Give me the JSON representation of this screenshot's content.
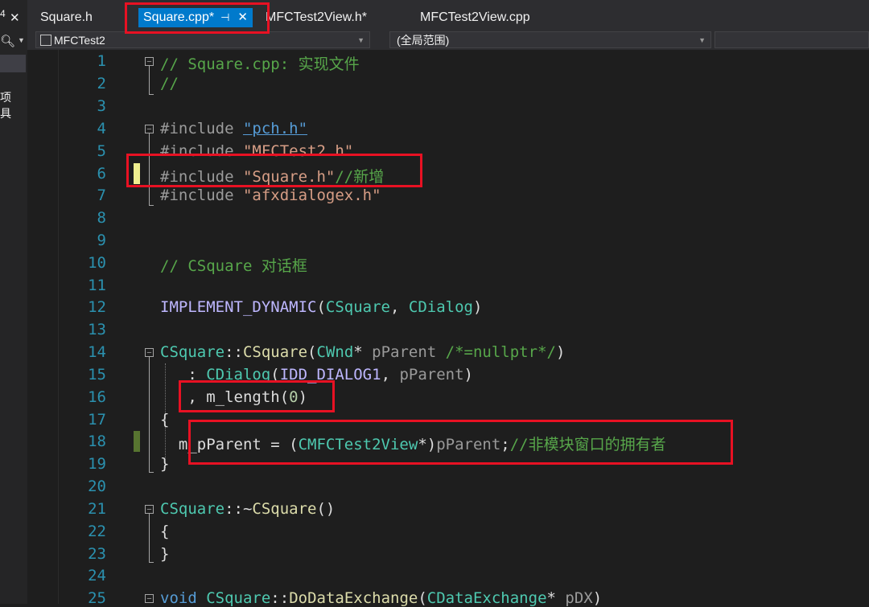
{
  "left_panel": {
    "glyph_top": "4",
    "glyph_close": "✕",
    "text1": "项",
    "text2": "具"
  },
  "tabs": [
    {
      "label": "Square.h"
    },
    {
      "label": "Square.cpp*",
      "active": true
    },
    {
      "label": "MFCTest2View.h*"
    },
    {
      "label": "MFCTest2View.cpp"
    }
  ],
  "nav": {
    "project": "MFCTest2",
    "scope": "(全局范围)"
  },
  "code": {
    "l1_comment": "// Square.cpp: 实现文件",
    "l2_comment": "//",
    "l4_dir": "#include ",
    "l4_file": "\"pch.h\"",
    "l5_dir": "#include ",
    "l5_file": "\"MFCTest2.h\"",
    "l6_dir": "#include ",
    "l6_file": "\"Square.h\"",
    "l6_comment": "//新增",
    "l7_dir": "#include ",
    "l7_file": "\"afxdialogex.h\"",
    "l10_comment": "// CSquare 对话框",
    "l12_macro": "IMPLEMENT_DYNAMIC",
    "l12_open": "(",
    "l12_a": "CSquare",
    "l12_sep": ", ",
    "l12_b": "CDialog",
    "l12_close": ")",
    "l14_cls": "CSquare",
    "l14_scope": "::",
    "l14_fn": "CSquare",
    "l14_open": "(",
    "l14_type": "CWnd",
    "l14_star": "* ",
    "l14_param": "pParent",
    "l14_comment": " /*=nullptr*/",
    "l14_close": ")",
    "l15_colon": "   : ",
    "l15_type": "CDialog",
    "l15_open": "(",
    "l15_macro": "IDD_DIALOG1",
    "l15_sep": ", ",
    "l15_param": "pParent",
    "l15_close": ")",
    "l16_pre": "   , m_length(",
    "l16_num": "0",
    "l16_post": ")",
    "l17": "{",
    "l18_pre": "  m_pParent = (",
    "l18_type": "CMFCTest2View",
    "l18_mid": "*)",
    "l18_param": "pParent",
    "l18_semi": ";",
    "l18_comment": "//非模块窗口的拥有者",
    "l19": "}",
    "l21_cls": "CSquare",
    "l21_scope": "::~",
    "l21_fn": "CSquare",
    "l21_paren": "()",
    "l22": "{",
    "l23": "}",
    "l25_kw": "void",
    "l25_sp": " ",
    "l25_cls": "CSquare",
    "l25_scope": "::",
    "l25_fn": "DoDataExchange",
    "l25_open": "(",
    "l25_type": "CDataExchange",
    "l25_star": "* ",
    "l25_param": "pDX",
    "l25_close": ")"
  },
  "line_numbers": [
    "1",
    "2",
    "3",
    "4",
    "5",
    "6",
    "7",
    "8",
    "9",
    "10",
    "11",
    "12",
    "13",
    "14",
    "15",
    "16",
    "17",
    "18",
    "19",
    "20",
    "21",
    "22",
    "23",
    "24",
    "25"
  ],
  "colors": {
    "accent": "#007acc",
    "annotation": "#e81123",
    "comment": "#57a64a",
    "string": "#d69d85",
    "type": "#4ec9b0"
  }
}
